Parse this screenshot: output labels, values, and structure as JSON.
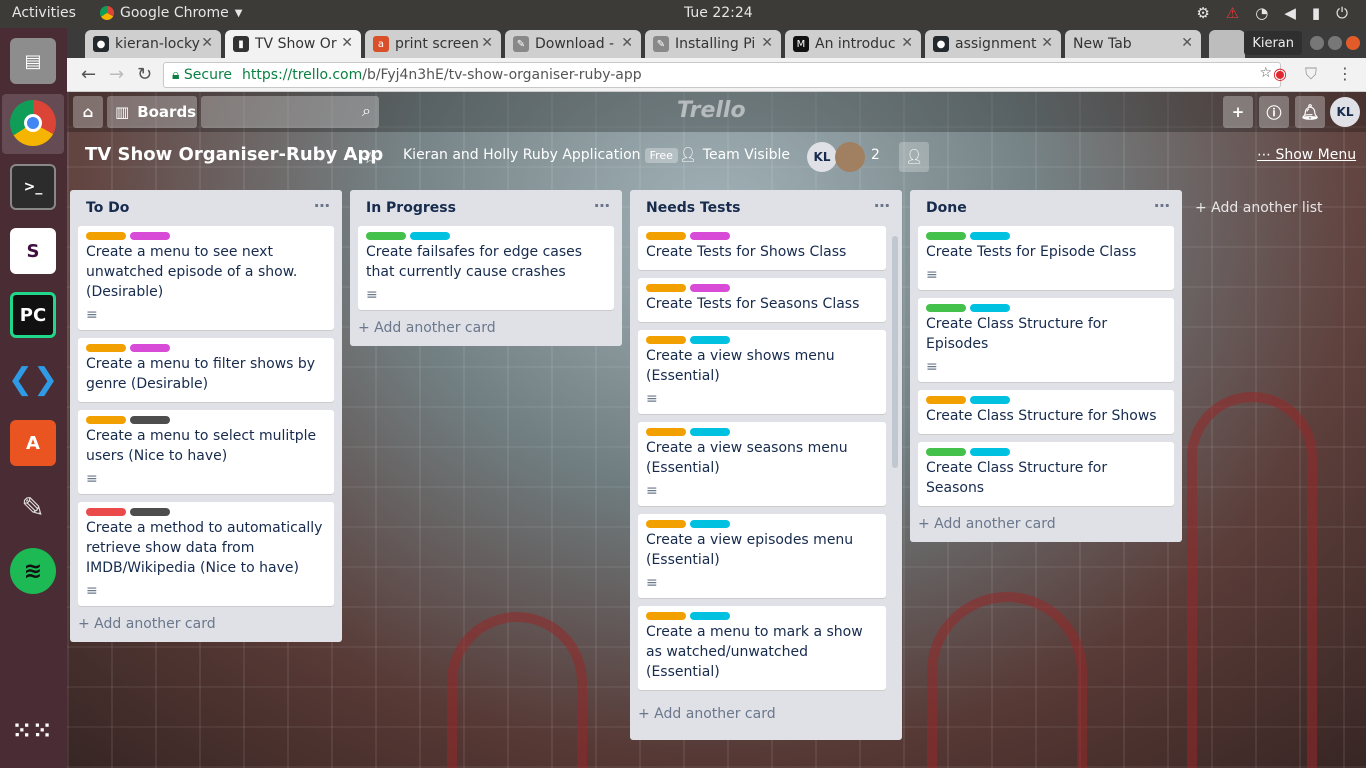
{
  "os": {
    "activities": "Activities",
    "app_name": "Google Chrome",
    "clock": "Tue 22:24"
  },
  "launcher": [
    "files-icon",
    "chrome-icon",
    "terminal-icon",
    "slack-icon",
    "pycharm-icon",
    "vscode-icon",
    "software-center-icon",
    "gimp-icon",
    "spotify-icon",
    "app-grid-icon"
  ],
  "tabs": [
    {
      "label": "kieran-locky",
      "color": "#24292e"
    },
    {
      "label": "TV Show Or",
      "color": "#333333"
    },
    {
      "label": "print screen",
      "color": "#d94f2a"
    },
    {
      "label": "Download -",
      "color": "#666666"
    },
    {
      "label": "Installing Pi",
      "color": "#666666"
    },
    {
      "label": "An introduc",
      "color": "#111111"
    },
    {
      "label": "assignment",
      "color": "#24292e"
    },
    {
      "label": "New Tab",
      "color": "#cccccc"
    }
  ],
  "profile": "Kieran",
  "address": {
    "secure": "Secure",
    "host": "https://trello.com",
    "path": "/b/Fyj4n3hE/tv-show-organiser-ruby-app"
  },
  "board": {
    "header": {
      "boards": "Boards",
      "logo": "Trello",
      "avatar": "KL"
    },
    "title": "TV Show Organiser-Ruby App",
    "team": "Kieran and Holly Ruby Application",
    "plan": "Free",
    "visibility": "Team Visible",
    "member_initials": "KL",
    "member_count": "2",
    "show_menu": "Show Menu",
    "add_list": "+ Add another list",
    "add_card": "+ Add another card"
  },
  "lists": [
    {
      "title": "To Do",
      "cards": [
        {
          "labels": [
            "#f2a000",
            "#d84bd6"
          ],
          "text": "Create a menu to see next unwatched episode of a show. (Desirable)",
          "desc": true
        },
        {
          "labels": [
            "#f2a000",
            "#d84bd6"
          ],
          "text": "Create a menu to filter shows by genre (Desirable)",
          "desc": false
        },
        {
          "labels": [
            "#f2a000",
            "#4d4d4d"
          ],
          "text": "Create a menu to select mulitple users (Nice to have)",
          "desc": true
        },
        {
          "labels": [
            "#eb4a4a",
            "#4d4d4d"
          ],
          "text": "Create a method to automatically retrieve show data from IMDB/Wikipedia (Nice to have)",
          "desc": true
        }
      ]
    },
    {
      "title": "In Progress",
      "cards": [
        {
          "labels": [
            "#44c14a",
            "#00c2e0"
          ],
          "text": "Create failsafes for edge cases that currently cause crashes",
          "desc": true
        }
      ]
    },
    {
      "title": "Needs Tests",
      "cards": [
        {
          "labels": [
            "#f2a000",
            "#d84bd6"
          ],
          "text": "Create Tests for Shows Class",
          "desc": false
        },
        {
          "labels": [
            "#f2a000",
            "#d84bd6"
          ],
          "text": "Create Tests for Seasons Class",
          "desc": false
        },
        {
          "labels": [
            "#f2a000",
            "#00c2e0"
          ],
          "text": "Create a view shows menu (Essential)",
          "desc": true
        },
        {
          "labels": [
            "#f2a000",
            "#00c2e0"
          ],
          "text": "Create a view seasons menu (Essential)",
          "desc": true
        },
        {
          "labels": [
            "#f2a000",
            "#00c2e0"
          ],
          "text": "Create a view episodes menu (Essential)",
          "desc": true
        },
        {
          "labels": [
            "#f2a000",
            "#00c2e0"
          ],
          "text": "Create a menu to mark a show as watched/unwatched (Essential)",
          "desc": false
        }
      ]
    },
    {
      "title": "Done",
      "cards": [
        {
          "labels": [
            "#44c14a",
            "#00c2e0"
          ],
          "text": "Create Tests for Episode Class",
          "desc": true
        },
        {
          "labels": [
            "#44c14a",
            "#00c2e0"
          ],
          "text": "Create Class Structure for Episodes",
          "desc": true
        },
        {
          "labels": [
            "#f2a000",
            "#00c2e0"
          ],
          "text": "Create Class Structure for Shows",
          "desc": false
        },
        {
          "labels": [
            "#44c14a",
            "#00c2e0"
          ],
          "text": "Create Class Structure for Seasons",
          "desc": false
        }
      ]
    }
  ]
}
